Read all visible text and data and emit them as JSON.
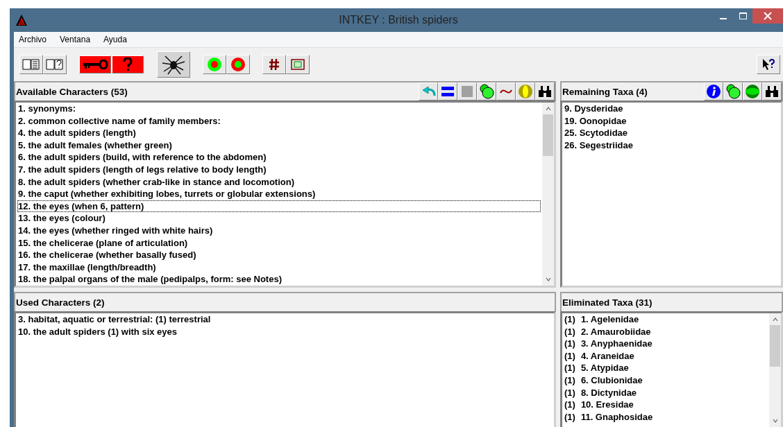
{
  "window": {
    "title": "INTKEY : British spiders"
  },
  "menu": [
    "Archivo",
    "Ventana",
    "Ayuda"
  ],
  "toolbar": [
    {
      "kind": "book-list"
    },
    {
      "kind": "book-help"
    },
    {
      "kind": "sep"
    },
    {
      "kind": "key"
    },
    {
      "kind": "question"
    },
    {
      "kind": "sep"
    },
    {
      "kind": "spider"
    },
    {
      "kind": "sep"
    },
    {
      "kind": "ring-red"
    },
    {
      "kind": "ring-green"
    },
    {
      "kind": "sep"
    },
    {
      "kind": "hash"
    },
    {
      "kind": "frame"
    }
  ],
  "available": {
    "title": "Available Characters (53)",
    "tools": [
      {
        "kind": "undo"
      },
      {
        "kind": "equals"
      },
      {
        "kind": "square"
      },
      {
        "kind": "circles"
      },
      {
        "kind": "tilde"
      },
      {
        "kind": "oval"
      },
      {
        "kind": "binoculars"
      }
    ],
    "items": [
      {
        "label": "1. synonyms:",
        "focused": false
      },
      {
        "label": "2. common collective name of family members:",
        "focused": false
      },
      {
        "label": "4. the adult spiders (length)",
        "focused": false
      },
      {
        "label": "5. the adult females (whether green)",
        "focused": false
      },
      {
        "label": "6. the adult spiders (build, with reference to the abdomen)",
        "focused": false
      },
      {
        "label": "7. the adult spiders (length of legs relative to body length)",
        "focused": false
      },
      {
        "label": "8. the adult spiders (whether crab-like in stance and locomotion)",
        "focused": false
      },
      {
        "label": "9. the caput (whether exhibiting lobes, turrets or globular extensions)",
        "focused": false
      },
      {
        "label": "12. the eyes (when 6, pattern)",
        "focused": true
      },
      {
        "label": "13. the eyes (colour)",
        "focused": false
      },
      {
        "label": "14. the eyes (whether ringed with white hairs)",
        "focused": false
      },
      {
        "label": "15. the chelicerae (plane of articulation)",
        "focused": false
      },
      {
        "label": "16. the chelicerae (whether basally fused)",
        "focused": false
      },
      {
        "label": "17. the maxillae (length/breadth)",
        "focused": false
      },
      {
        "label": "18. the palpal organs of the male (pedipalps, form: see Notes)",
        "focused": false
      }
    ]
  },
  "remaining": {
    "title": "Remaining Taxa (4)",
    "tools": [
      {
        "kind": "info"
      },
      {
        "kind": "circles"
      },
      {
        "kind": "oval-green"
      },
      {
        "kind": "binoculars"
      }
    ],
    "items": [
      "9. Dysderidae",
      "19. Oonopidae",
      "25. Scytodidae",
      "26. Segestriidae"
    ]
  },
  "used": {
    "title": "Used Characters (2)",
    "items": [
      "3. habitat, aquatic or terrestrial: (1) terrestrial",
      "10. the adult spiders (1) with six eyes"
    ]
  },
  "eliminated": {
    "title": "Eliminated Taxa (31)",
    "items": [
      {
        "code": "(1)",
        "label": "1. Agelenidae"
      },
      {
        "code": "(1)",
        "label": "2. Amaurobiidae"
      },
      {
        "code": "(1)",
        "label": "3. Anyphaenidae"
      },
      {
        "code": "(1)",
        "label": "4. Araneidae"
      },
      {
        "code": "(1)",
        "label": "5. Atypidae"
      },
      {
        "code": "(1)",
        "label": "6. Clubionidae"
      },
      {
        "code": "(1)",
        "label": "8. Dictynidae"
      },
      {
        "code": "(1)",
        "label": "10. Eresidae"
      },
      {
        "code": "(1)",
        "label": "11. Gnaphosidae"
      }
    ]
  }
}
